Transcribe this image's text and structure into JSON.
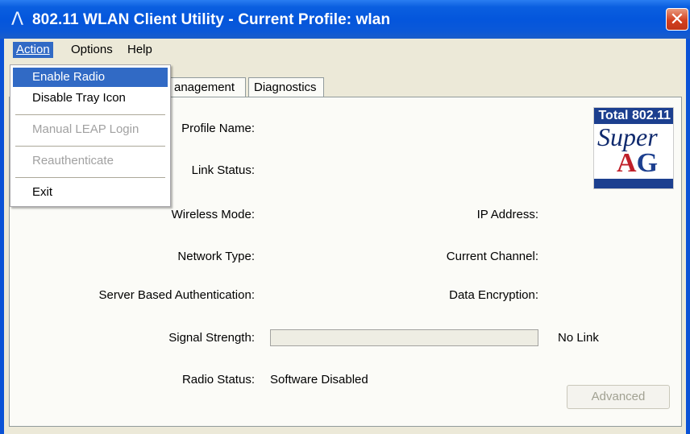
{
  "window": {
    "title": "802.11 WLAN Client Utility - Current Profile: wlan",
    "icon": "lambda-icon",
    "close_glyph": "✕"
  },
  "menubar": {
    "action": "Action",
    "options": "Options",
    "help": "Help"
  },
  "tabs": {
    "management": "anagement",
    "diagnostics": "Diagnostics"
  },
  "dropdown": {
    "items": [
      {
        "label": "Enable Radio",
        "state": "highlighted"
      },
      {
        "label": "Disable Tray Icon",
        "state": "enabled"
      },
      {
        "label": "Manual LEAP Login",
        "state": "disabled"
      },
      {
        "label": "Reauthenticate",
        "state": "disabled"
      },
      {
        "label": "Exit",
        "state": "enabled"
      }
    ]
  },
  "status": {
    "profile_name_label": "Profile Name:",
    "link_status_label": "Link Status:",
    "wireless_mode_label": "Wireless Mode:",
    "ip_address_label": "IP Address:",
    "network_type_label": "Network Type:",
    "current_channel_label": "Current Channel:",
    "server_auth_label": "Server Based Authentication:",
    "data_encryption_label": "Data Encryption:",
    "signal_strength_label": "Signal Strength:",
    "signal_strength_value": "No Link",
    "signal_strength_level": 0,
    "radio_status_label": "Radio Status:",
    "radio_status_value": "Software Disabled"
  },
  "buttons": {
    "advanced": "Advanced"
  },
  "logo": {
    "top_text": "Total 802.11",
    "super_text": "Super",
    "a_text": "A",
    "g_text": "G"
  },
  "colors": {
    "titlebar": "#0456dc",
    "highlight": "#316ac5",
    "disabled_text": "#a1a1a1",
    "close_button": "#d4401f"
  }
}
